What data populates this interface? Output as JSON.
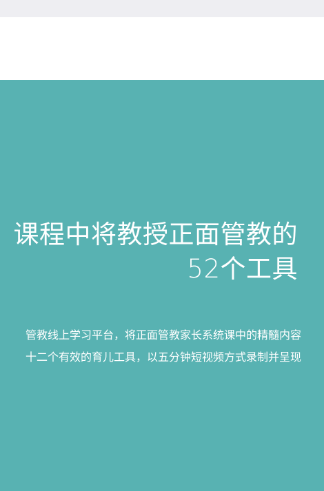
{
  "hero": {
    "title_line1": "课程中将教授正面管教的",
    "title_line2": "52个工具",
    "desc_line1": "管教线上学习平台，将正面管教家长系统课中的精髓内容",
    "desc_line2": "十二个有效的育儿工具，以五分钟短视频方式录制并呈现"
  },
  "colors": {
    "hero_bg": "#58b2b2",
    "header_bg": "#ffffff",
    "top_strip": "#eeeef2"
  }
}
